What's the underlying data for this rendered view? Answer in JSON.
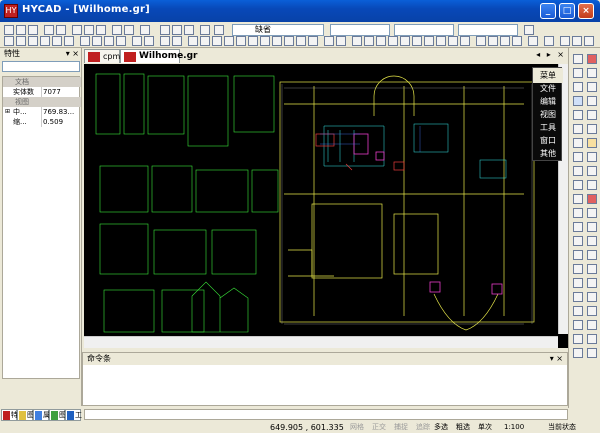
{
  "window": {
    "title": "HYCAD - [Wilhome.gr]",
    "app_icon": "HY"
  },
  "toolbar": {
    "layer_value": "缺省"
  },
  "properties": {
    "title": "特性",
    "pin": "▾ × ",
    "sections": [
      {
        "label": "文档",
        "rows": [
          {
            "name": "实体数",
            "value": "7077"
          }
        ]
      },
      {
        "label": "视图",
        "rows": [
          {
            "name": "中...",
            "value": "769.83..."
          },
          {
            "name": "缩...",
            "value": "0.509"
          }
        ]
      }
    ],
    "bottom_tabs": [
      "特",
      "图",
      "属",
      "图",
      "工"
    ]
  },
  "document_tabs": [
    {
      "label": "cpm.gr",
      "active": false
    },
    {
      "label": "Wilhome.gr",
      "active": true
    }
  ],
  "tab_arrows": "◂ ▸ ×",
  "context_menu": {
    "items": [
      "菜单",
      "文件",
      "编辑",
      "视图",
      "工具",
      "窗口",
      "其他"
    ],
    "highlight_index": 0
  },
  "command_panel": {
    "title": "命令条",
    "close": "▾ ×"
  },
  "status_bar": {
    "coordinates": "649.905 ,   601.335",
    "toggles": [
      "网格",
      "正交",
      "捕捉",
      "追踪"
    ],
    "mode_buttons": [
      "多选",
      "粗选",
      "单次"
    ],
    "scale": "1:100",
    "status": "当前状态"
  },
  "colors": {
    "title_bar": "#0842a8",
    "canvas_bg": "#000000",
    "drawing_yellow": "#e8e84a",
    "drawing_green": "#3ae63a",
    "drawing_cyan": "#35e6e6"
  }
}
